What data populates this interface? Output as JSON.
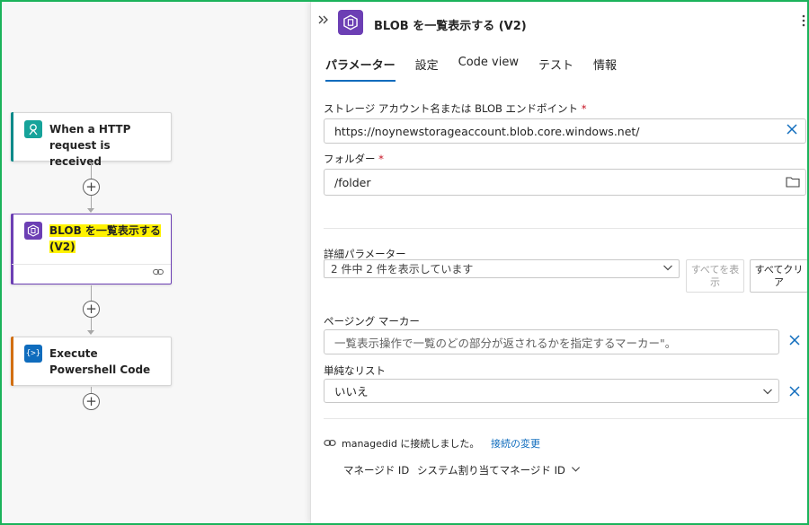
{
  "canvas": {
    "trigger": {
      "title": "When a HTTP request is received"
    },
    "action1": {
      "title": "BLOB を一覧表示する (V2)"
    },
    "action2": {
      "title": "Execute Powershell Code"
    },
    "plus_symbol": "+"
  },
  "panel": {
    "title": "BLOB を一覧表示する (V2)",
    "tabs": [
      "パラメーター",
      "設定",
      "Code view",
      "テスト",
      "情報"
    ],
    "active_tab": "パラメーター",
    "fields": {
      "storage": {
        "label": "ストレージ アカウント名または BLOB エンドポイント",
        "required_mark": "*",
        "value": "https://noynewstorageaccount.blob.core.windows.net/"
      },
      "folder": {
        "label": "フォルダー",
        "required_mark": "*",
        "value": "/folder"
      }
    },
    "advanced": {
      "label": "詳細パラメーター",
      "dropdown_value": "2 件中 2 件を表示しています",
      "show_all": "すべてを表示",
      "clear_all": "すべてクリア"
    },
    "paging": {
      "label": "ページング マーカー",
      "placeholder": "一覧表示操作で一覧のどの部分が返されるかを指定するマーカー\"。"
    },
    "flat": {
      "label": "単純なリスト",
      "value": "いいえ"
    },
    "connection": {
      "text": "managedid に接続しました。",
      "change_link": "接続の変更",
      "managed_id_label": "マネージド ID",
      "managed_id_value": "システム割り当てマネージド ID"
    }
  },
  "colors": {
    "accent": "#0f6cbd",
    "blob_purple": "#6c3fb4",
    "http_teal": "#16a39a",
    "highlight": "#fff200",
    "frame_green": "#1bb35b"
  }
}
